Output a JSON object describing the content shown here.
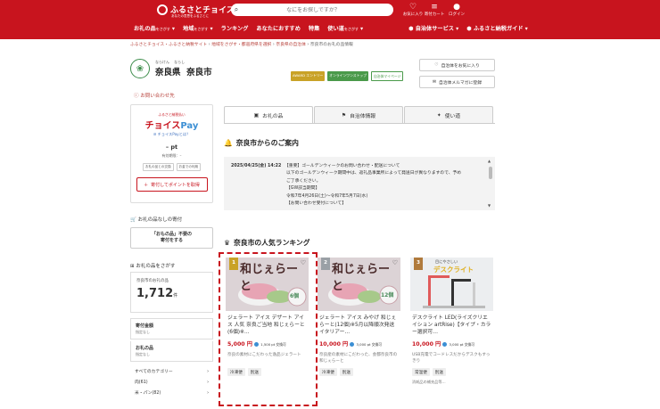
{
  "header": {
    "logo_title": "ふるさとチョイス",
    "logo_sub": "あなたの意思をふるさとに",
    "search_placeholder": "なにをお探しですか？",
    "icons": [
      {
        "name": "heart-icon",
        "label": "お気に入り",
        "glyph": "♡"
      },
      {
        "name": "history-icon",
        "label": "寄付カート",
        "glyph": "≡"
      },
      {
        "name": "user-icon",
        "label": "ログイン",
        "glyph": "●"
      }
    ],
    "nav": [
      {
        "label": "お礼の品",
        "sub": "をさがす"
      },
      {
        "label": "地域",
        "sub": "をさがす"
      },
      {
        "label": "ランキング",
        "sub": ""
      },
      {
        "label": "あなたにおすすめ",
        "sub": ""
      },
      {
        "label": "特集",
        "sub": ""
      },
      {
        "label": "使い道",
        "sub": "をさがす"
      },
      {
        "label": "自治体サービス",
        "sub": ""
      },
      {
        "label": "ふるさと納税ガイド",
        "sub": ""
      }
    ]
  },
  "breadcrumb": [
    "ふるさとチョイス・ふるさと納税サイト",
    "地域をさがす・都道府県を選択",
    "奈良県の自治体",
    "奈良市のお礼の品情報"
  ],
  "city": {
    "pref": "奈良県",
    "pref_ruby": "ならけん",
    "name": "奈良市",
    "name_ruby": "ならし",
    "contact": "お問い合わせ先",
    "badges": [
      {
        "label": "AWARD エントリー",
        "color": "#c9a227"
      },
      {
        "label": "オンラインワンストップ",
        "color": "#4a9a4a"
      },
      {
        "label": "自治体マイページ",
        "color": "#4a9a4a"
      }
    ],
    "fav_btn": "自治体をお気に入り",
    "mail_btn": "自治体メルマガに登録"
  },
  "choice_pay": {
    "top": "ふるさと納税払い",
    "logo_a": "チョイス",
    "logo_b": "Pay",
    "what": "チョイスPayとは？",
    "pt": "– pt",
    "exp": "有効期限：–",
    "chip1": "お礼の品との交換",
    "chip2": "お金での利用",
    "btn": "寄付してポイントを取得"
  },
  "side": {
    "nashi_h": "お礼の品なしの寄付",
    "omono_l1": "「おもの品」不要の",
    "omono_l2": "寄付をする",
    "search_h": "お礼の品をさがす",
    "count_label": "奈良市のお礼の品",
    "count": "1,712",
    "count_unit": "件",
    "amount_h": "寄付金額",
    "amount_s": "指定なし",
    "item_h": "お礼の品",
    "item_s": "指定なし",
    "cats": [
      {
        "name": "すべてのカテゴリー",
        "arrow": "›"
      },
      {
        "name": "肉(61)",
        "arrow": "›"
      },
      {
        "name": "米・パン(82)",
        "arrow": "›"
      }
    ]
  },
  "tabs": [
    {
      "label": "お礼の品",
      "icon": "gift-icon",
      "glyph": "▣"
    },
    {
      "label": "自治体情報",
      "icon": "flag-icon",
      "glyph": "⚑"
    },
    {
      "label": "使い道",
      "icon": "people-icon",
      "glyph": "✦"
    }
  ],
  "notice": {
    "heading": "奈良市からのご案内",
    "date": "2025/04/25(金) 14:22",
    "title": "【重要】ゴールデンウィークのお問い合わせ・配送について",
    "body": [
      "以下のゴールデンウィーク期間中は、返礼品事業所によって発送日が異なりますので、予め",
      "ご了承ください。",
      "【GW該当期間】",
      "令和7年4月26日(土)～令和7年5月7日(水)",
      "【お問い合わせ受付について】"
    ]
  },
  "ranking": {
    "heading": "奈良市の人気ランキング",
    "items": [
      {
        "rank": "1",
        "rank_color": "#c9a227",
        "title": "ジェラート アイス デザート アイス 人気 奈良ご当地 和じぇらーと(6個)※…",
        "price": "5,000 円",
        "pt": "1,500 pt 交換可",
        "desc": "奈良の素材にこだわった逸品ジェラート",
        "tags": [
          "冷凍便",
          "別送"
        ],
        "img_text": "和じぇらーと",
        "img_badge": "6個",
        "img_bg": "#d9cfd2"
      },
      {
        "rank": "2",
        "rank_color": "#9aa0a6",
        "title": "ジェラート アイス みやげ 和じぇらーと(12個)※5月以降順次発送 イタリアー…",
        "price": "10,000 円",
        "pt": "3,000 pt 交換可",
        "desc": "奈良産の素材にこだわった、会都奈良市の和じぇらーと",
        "tags": [
          "冷凍便",
          "別送"
        ],
        "img_text": "和じぇらーと",
        "img_badge": "12個",
        "img_bg": "#d9cfd2"
      },
      {
        "rank": "3",
        "rank_color": "#b07a3c",
        "title": "デスクライト LED(ライズクリエイション artRise)【タイプ・カラー選択可…",
        "price": "10,000 円",
        "pt": "3,000 pt 交換可",
        "desc": "USB充電でコードレスだからデスクもすっきり",
        "tags": [
          "常温便",
          "別送"
        ],
        "extra": "消耗品の補充品等…",
        "img_text": "デスクライト",
        "img_sub": "目にやさしい",
        "img_badge": "",
        "img_bg": "#eef0f2"
      }
    ]
  },
  "colors": {
    "brand": "#c8141e",
    "link": "#b8423c"
  }
}
